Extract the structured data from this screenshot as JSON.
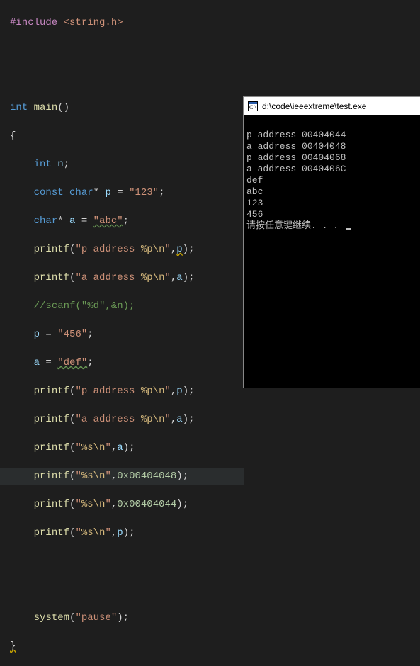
{
  "code": {
    "include_directive": "#include",
    "include_header": "<string.h>",
    "type_int": "int",
    "type_const": "const",
    "type_char": "char",
    "fn_main": "main",
    "fn_printf": "printf",
    "fn_system": "system",
    "fn_scanf": "scanf",
    "var_n": "n",
    "var_p": "p",
    "var_a": "a",
    "str_123": "\"123\"",
    "str_abc": "\"abc\"",
    "str_456": "\"456\"",
    "str_def": "\"def\"",
    "str_paddr_pre": "\"p address ",
    "str_aaddr_pre": "\"a address ",
    "str_spec_p": "%p",
    "str_spec_s": "%s",
    "str_spec_d": "%d",
    "str_nl": "\\n",
    "str_close": "\"",
    "str_amp_n": "&n",
    "hex1": "0x00404048",
    "hex2": "0x00404044",
    "str_pause": "\"pause\"",
    "comment_scanf": "//scanf(\"%d\",&n);"
  },
  "console": {
    "title": "d:\\code\\ieeextreme\\test.exe",
    "lines": [
      "p address 00404044",
      "a address 00404048",
      "p address 00404068",
      "a address 0040406C",
      "def",
      "abc",
      "123",
      "456",
      "请按任意键继续. . . "
    ]
  }
}
